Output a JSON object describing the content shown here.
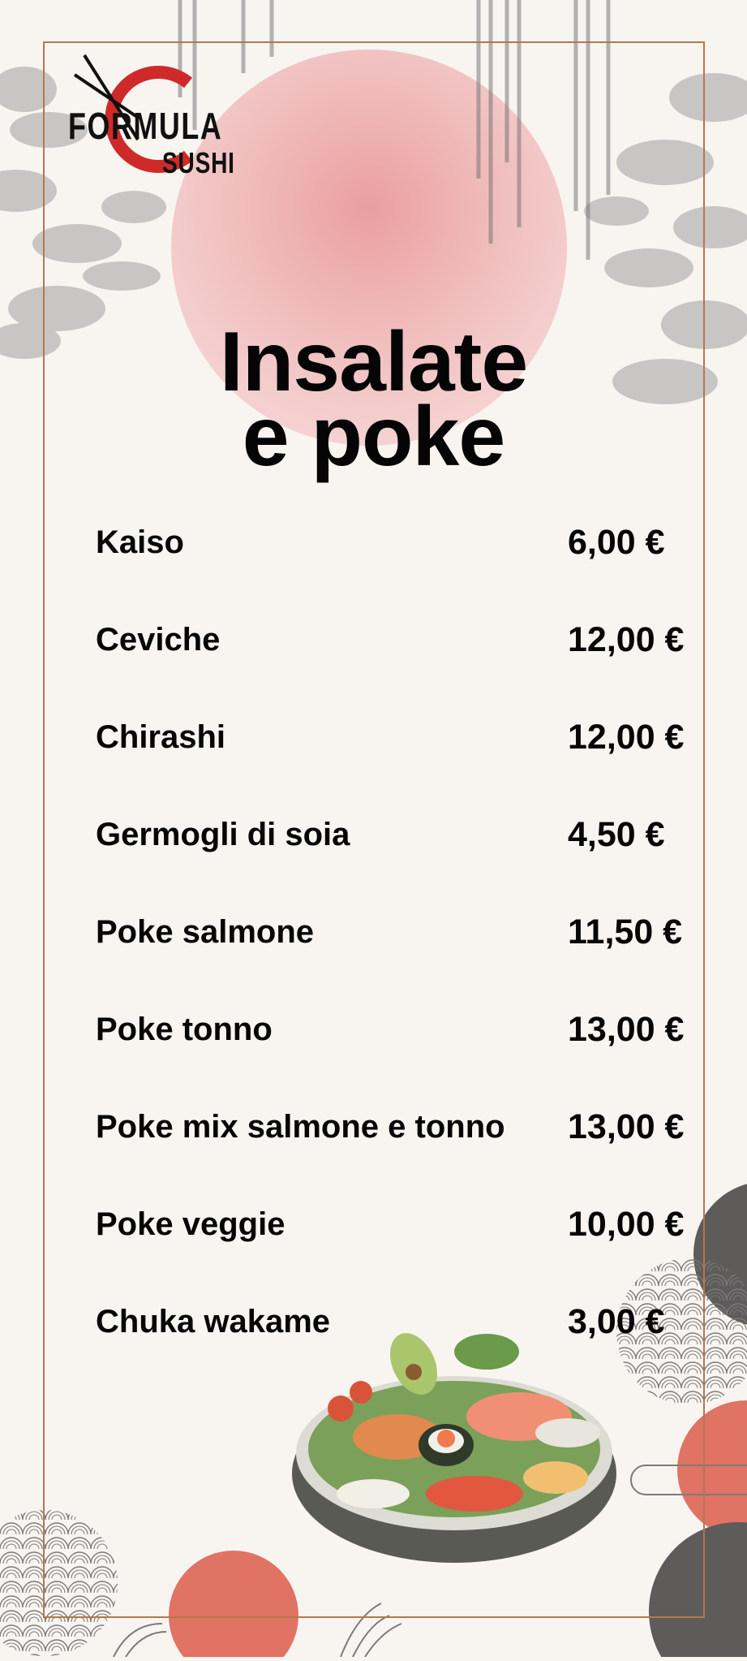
{
  "brand": {
    "logo_main": "FORMULA",
    "logo_sub": "SUSHI",
    "accent_color": "#cf2a2a",
    "frame_color": "#b3784e"
  },
  "header": {
    "title_line1": "Insalate",
    "title_line2": "e poke"
  },
  "menu": {
    "items": [
      {
        "name": "Kaiso",
        "price": "6,00 €"
      },
      {
        "name": "Ceviche",
        "price": "12,00 €"
      },
      {
        "name": "Chirashi",
        "price": "12,00 €"
      },
      {
        "name": "Germogli di soia",
        "price": "4,50 €"
      },
      {
        "name": "Poke salmone",
        "price": "11,50 €"
      },
      {
        "name": "Poke tonno",
        "price": "13,00 €"
      },
      {
        "name": "Poke mix salmone e tonno",
        "price": "13,00 €"
      },
      {
        "name": "Poke veggie",
        "price": "10,00 €"
      },
      {
        "name": "Chuka wakame",
        "price": "3,00 €"
      }
    ]
  }
}
